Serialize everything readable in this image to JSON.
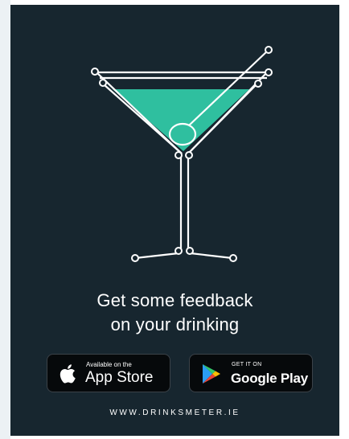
{
  "headline": {
    "line1": "Get some feedback",
    "line2": "on your drinking"
  },
  "badges": {
    "app_store": {
      "small_text": "Available on the",
      "big_text": "App Store",
      "icon": "apple-icon"
    },
    "google_play": {
      "small_text": "GET IT ON",
      "big_text": "Google Play",
      "icon": "google-play-icon"
    }
  },
  "site_url": "WWW.DRINKSMETER.IE",
  "colors": {
    "background": "#17262f",
    "liquid": "#2fbf9f",
    "line": "#ffffff",
    "badge": "#06090b"
  },
  "illustration": "martini-glass-icon"
}
